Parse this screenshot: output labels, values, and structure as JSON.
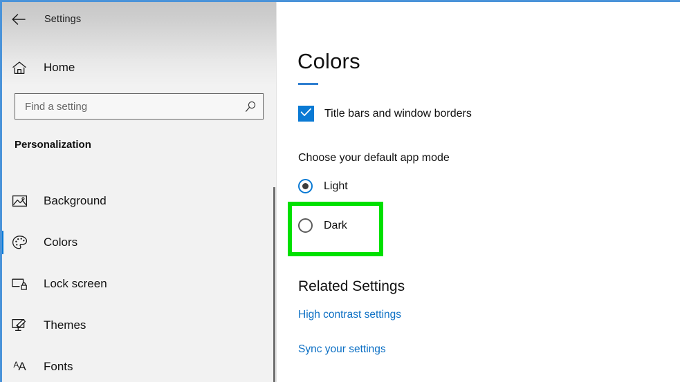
{
  "window": {
    "accent_color": "#4a93d9",
    "brand_blue": "#0078d7",
    "highlight_green": "#00e000"
  },
  "titlebar": {
    "back_label": "Back",
    "title": "Settings",
    "back_icon": "arrow-left-icon"
  },
  "sidebar": {
    "home": {
      "label": "Home",
      "icon": "home-icon"
    },
    "search": {
      "value": "",
      "placeholder": "Find a setting",
      "icon": "search-icon"
    },
    "section_title": "Personalization",
    "items": [
      {
        "label": "Background",
        "icon": "image-icon",
        "selected": false
      },
      {
        "label": "Colors",
        "icon": "palette-icon",
        "selected": true
      },
      {
        "label": "Lock screen",
        "icon": "monitor-lock-icon",
        "selected": false
      },
      {
        "label": "Themes",
        "icon": "monitor-brush-icon",
        "selected": false
      },
      {
        "label": "Fonts",
        "icon": "font-aa-icon",
        "selected": false
      }
    ]
  },
  "content": {
    "page_title": "Colors",
    "checkbox": {
      "label": "Title bars and window borders",
      "checked": true
    },
    "app_mode": {
      "group_label": "Choose your default app mode",
      "options": [
        {
          "label": "Light",
          "selected": true
        },
        {
          "label": "Dark",
          "selected": false
        }
      ],
      "highlighted_option": "Dark"
    },
    "related": {
      "heading": "Related Settings",
      "links": [
        {
          "label": "High contrast settings"
        },
        {
          "label": "Sync your settings"
        }
      ]
    }
  }
}
